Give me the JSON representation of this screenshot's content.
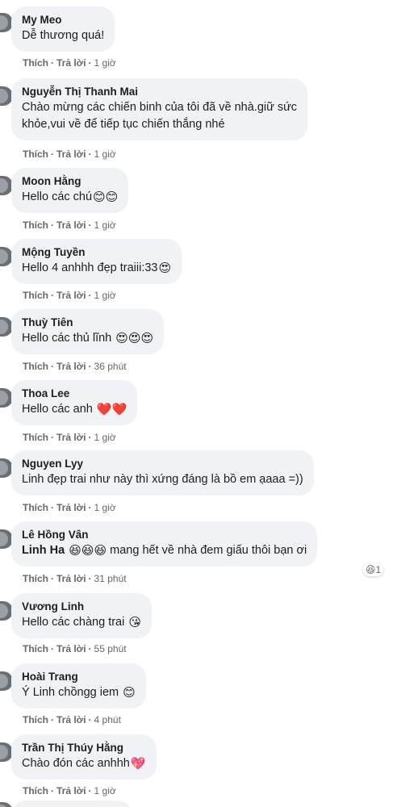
{
  "comments": [
    {
      "name": "My Meo",
      "text": "Dễ thương quá!",
      "like": "Thích",
      "reply": "Trả lời",
      "time": "1 giờ"
    },
    {
      "name": "Nguyễn Thị Thanh Mai",
      "text_line1": "Chào mừng các chiến binh của tôi đã về nhà.giữ sức",
      "text_line2": "khỏe,vui về để tiếp tục chiến thắng nhé",
      "like": "Thích",
      "reply": "Trả lời",
      "time": "1 giờ"
    },
    {
      "name": "Moon Hằng",
      "text": "Hello các chú",
      "emoji": "😊😊",
      "like": "Thích",
      "reply": "Trả lời",
      "time": "1 giờ"
    },
    {
      "name": "Mộng Tuyền",
      "text": "Hello 4 anhhh đẹp traiii:33",
      "emoji": "😍",
      "like": "Thích",
      "reply": "Trả lời",
      "time": "1 giờ"
    },
    {
      "name": "Thuỳ Tiên",
      "text": "Hello các thủ lĩnh",
      "emoji": "😍😍😍",
      "like": "Thích",
      "reply": "Trả lời",
      "time": "36 phút"
    },
    {
      "name": "Thoa Lee",
      "text": "Hello các anh",
      "emoji": "❤️❤️",
      "like": "Thích",
      "reply": "Trả lời",
      "time": "1 giờ"
    },
    {
      "name": "Nguyen Lyy",
      "text": "Linh đẹp trai như này thì xứng đáng là bồ em ạaaa =))",
      "like": "Thích",
      "reply": "Trả lời",
      "time": "1 giờ"
    },
    {
      "name": "Lê Hồng Vân",
      "mention": "Linh Ha",
      "emoji": "😆😆😆",
      "text": "mang hết về nhà đem giấu thôi bạn ơi",
      "reaction_emoji": "😆",
      "reaction_count": "1",
      "like": "Thích",
      "reply": "Trả lời",
      "time": "31 phút"
    },
    {
      "name": "Vương Linh",
      "text": "Hello các chàng trai",
      "emoji": "😘",
      "like": "Thích",
      "reply": "Trả lời",
      "time": "55 phút"
    },
    {
      "name": "Hoài Trang",
      "text": "Ý Linh chồngg iem",
      "emoji": "😊",
      "like": "Thích",
      "reply": "Trả lời",
      "time": "4 phút"
    },
    {
      "name": "Trần Thị Thúy Hằng",
      "text": "Chào đón các anhhh",
      "emoji": "💖",
      "like": "Thích",
      "reply": "Trả lời",
      "time": "1 giờ"
    }
  ],
  "separator": "·",
  "colors": {
    "bubble": "#f0f2f5",
    "text": "#1c1e21",
    "meta": "#65676b"
  },
  "icons": [
    "avatar-image",
    "reaction-haha-icon"
  ]
}
